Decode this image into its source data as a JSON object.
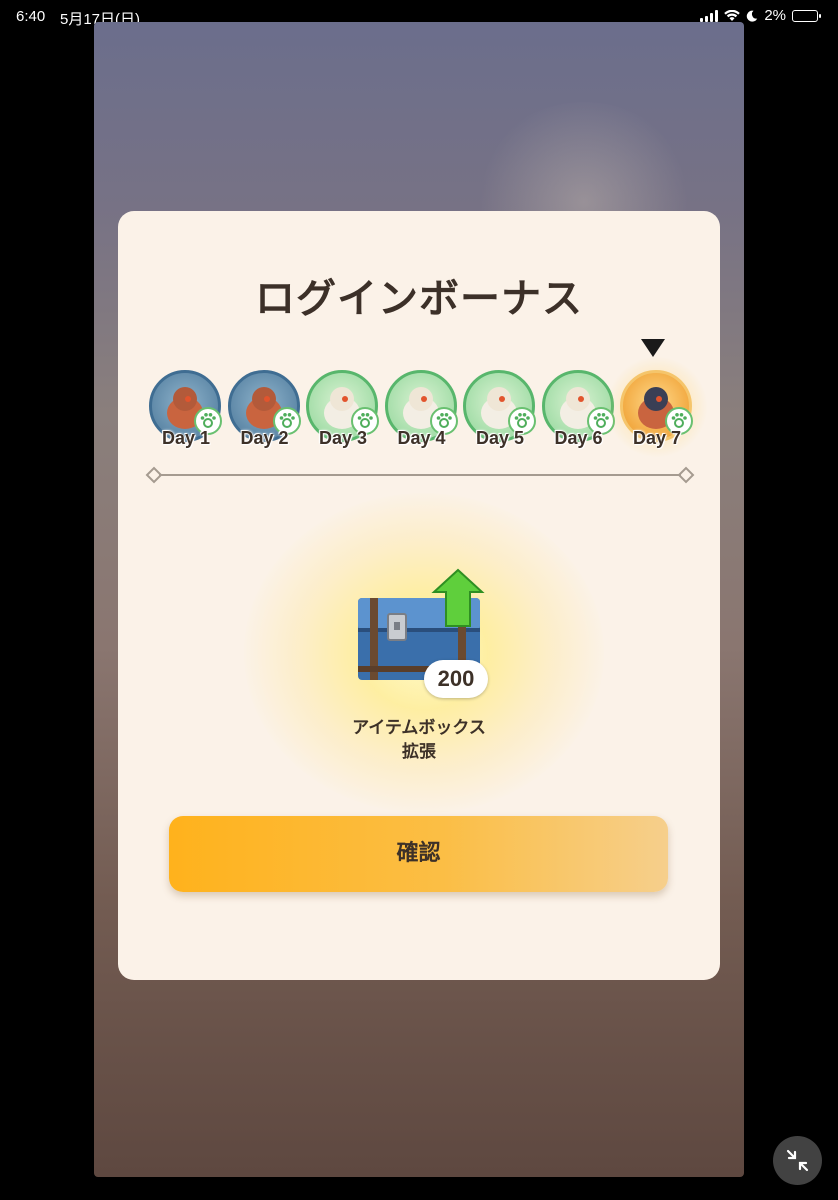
{
  "status_bar": {
    "time": "6:40",
    "date": "5月17日(日)",
    "battery": "2%",
    "icons": [
      "cellular-signal-icon",
      "wifi-icon",
      "do-not-disturb-moon-icon",
      "battery-icon"
    ]
  },
  "dialog": {
    "title": "ログインボーナス",
    "days": [
      {
        "label": "Day 1",
        "state": "claimed",
        "color": "#5f89a8"
      },
      {
        "label": "Day 2",
        "state": "claimed",
        "color": "#5f89a8"
      },
      {
        "label": "Day 3",
        "state": "claimed",
        "color": "#a6deaa"
      },
      {
        "label": "Day 4",
        "state": "claimed",
        "color": "#a6deaa"
      },
      {
        "label": "Day 5",
        "state": "claimed",
        "color": "#a6deaa"
      },
      {
        "label": "Day 6",
        "state": "claimed",
        "color": "#a6deaa"
      },
      {
        "label": "Day 7",
        "state": "current",
        "color": "#f1a63c"
      }
    ],
    "reward": {
      "icon": "item-box-chest-icon",
      "count": "200",
      "name_line1": "アイテムボックス",
      "name_line2": "拡張"
    },
    "confirm_label": "確認"
  },
  "colors": {
    "panel": "#fbf2e8",
    "button_start": "#ffb21c",
    "button_end": "#f6cf8c",
    "text": "#3d3128"
  }
}
